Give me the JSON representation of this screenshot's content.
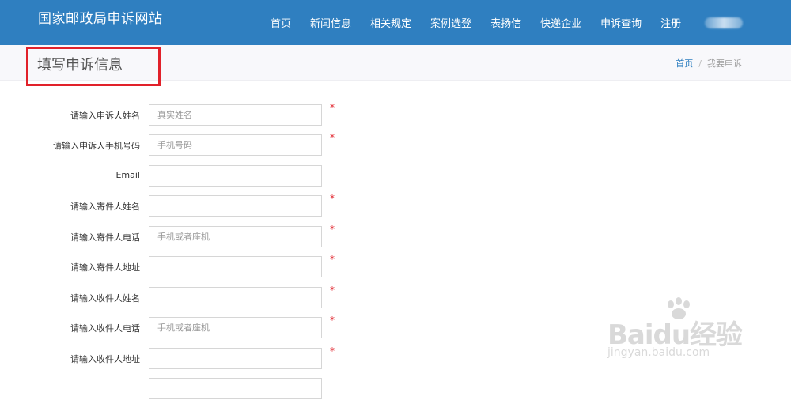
{
  "header": {
    "site_title": "国家邮政局申诉网站",
    "nav": [
      {
        "label": "首页"
      },
      {
        "label": "新闻信息"
      },
      {
        "label": "相关规定"
      },
      {
        "label": "案例选登"
      },
      {
        "label": "表扬信"
      },
      {
        "label": "快递企业"
      },
      {
        "label": "申诉查询"
      },
      {
        "label": "注册"
      }
    ]
  },
  "page": {
    "title": "填写申诉信息",
    "breadcrumb": {
      "home": "首页",
      "separator": "/",
      "current": "我要申诉"
    }
  },
  "form": {
    "required_mark": "*",
    "fields": [
      {
        "label": "请输入申诉人姓名",
        "placeholder": "真实姓名",
        "value": "",
        "required": true
      },
      {
        "label": "请输入申诉人手机号码",
        "placeholder": "手机号码",
        "value": "",
        "required": true
      },
      {
        "label": "Email",
        "placeholder": "",
        "value": "",
        "required": false
      },
      {
        "label": "请输入寄件人姓名",
        "placeholder": "",
        "value": "",
        "required": true
      },
      {
        "label": "请输入寄件人电话",
        "placeholder": "手机或者座机",
        "value": "",
        "required": true
      },
      {
        "label": "请输入寄件人地址",
        "placeholder": "",
        "value": "",
        "required": true
      },
      {
        "label": "请输入收件人姓名",
        "placeholder": "",
        "value": "",
        "required": true
      },
      {
        "label": "请输入收件人电话",
        "placeholder": "手机或者座机",
        "value": "",
        "required": true
      },
      {
        "label": "请输入收件人地址",
        "placeholder": "",
        "value": "",
        "required": true
      }
    ]
  },
  "watermark": {
    "brand": "Baidu经验",
    "url": "jingyan.baidu.com"
  },
  "colors": {
    "header_bg": "#2f7fc0",
    "highlight_box": "#e1212a",
    "required": "#e1212a",
    "link": "#2f7fc0"
  }
}
